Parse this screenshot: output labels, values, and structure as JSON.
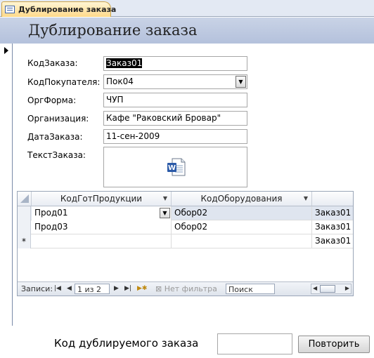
{
  "tab": {
    "label": "Дублирование заказа"
  },
  "form": {
    "title": "Дублирование заказа",
    "fields": {
      "order_id": {
        "label": "КодЗаказа:",
        "value": "Заказ01"
      },
      "customer_id": {
        "label": "КодПокупателя:",
        "value": "Пок04"
      },
      "org_form": {
        "label": "ОргФорма:",
        "value": "ЧУП"
      },
      "organization": {
        "label": "Организация:",
        "value": "Кафе \"Раковский Бровар\""
      },
      "order_date": {
        "label": "ДатаЗаказа:",
        "value": "11-сен-2009"
      },
      "order_text": {
        "label": "ТекстЗаказа:",
        "icon": "word-document-icon"
      }
    }
  },
  "subform": {
    "columns": [
      "КодГотПродукции",
      "КодОборудования",
      ""
    ],
    "rows": [
      [
        "Прод01",
        "Обор02",
        "Заказ01"
      ],
      [
        "Прод03",
        "Обор02",
        "Заказ01"
      ]
    ],
    "new_row": {
      "marker": "*",
      "third": "Заказ01"
    },
    "nav": {
      "records_label": "Записи:",
      "position": "1 из 2",
      "filter": "Нет фильтра",
      "search": "Поиск"
    }
  },
  "footer": {
    "duplicate_label": "Код дублируемого заказа",
    "duplicate_value": "",
    "repeat_button": "Повторить"
  }
}
